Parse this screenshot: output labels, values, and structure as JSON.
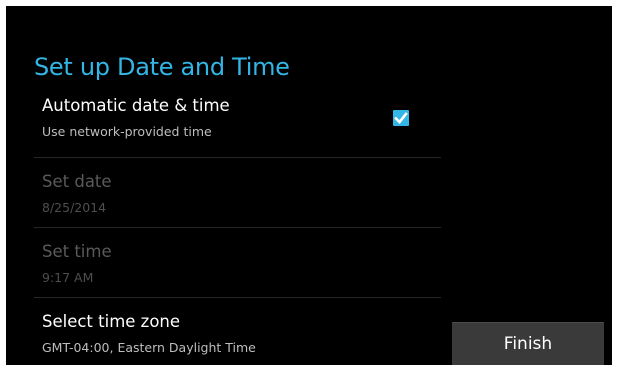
{
  "page": {
    "title": "Set up Date and Time"
  },
  "settings": {
    "items": [
      {
        "title": "Automatic date & time",
        "summary": "Use network-provided time",
        "checked": true,
        "enabled": true
      },
      {
        "title": "Set date",
        "summary": "8/25/2014",
        "enabled": false
      },
      {
        "title": "Set time",
        "summary": "9:17 AM",
        "enabled": false
      },
      {
        "title": "Select time zone",
        "summary": "GMT-04:00, Eastern Daylight Time",
        "enabled": true
      }
    ]
  },
  "actions": {
    "finish_label": "Finish"
  },
  "colors": {
    "accent": "#33b5e5",
    "background": "#000000",
    "button": "#3a3a3a"
  },
  "icons": {
    "checkbox": "checkbox-checked-icon"
  }
}
